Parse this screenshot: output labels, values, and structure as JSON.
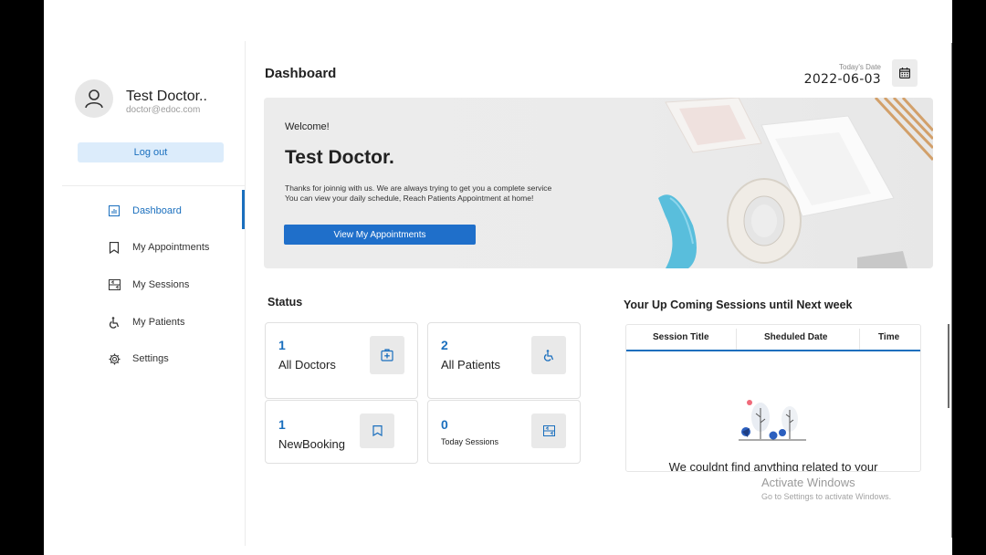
{
  "profile": {
    "name": "Test Doctor..",
    "email": "doctor@edoc.com",
    "avatar_icon": "user-icon"
  },
  "logout_label": "Log out",
  "nav": [
    {
      "label": "Dashboard",
      "icon": "dashboard-icon"
    },
    {
      "label": "My Appointments",
      "icon": "bookmark-icon"
    },
    {
      "label": "My Sessions",
      "icon": "sessions-icon"
    },
    {
      "label": "My Patients",
      "icon": "wheelchair-icon"
    },
    {
      "label": "Settings",
      "icon": "gear-icon"
    }
  ],
  "header": {
    "title": "Dashboard",
    "date_label": "Today's Date",
    "date_value": "2022-06-03",
    "calendar_icon": "calendar-icon"
  },
  "banner": {
    "welcome": "Welcome!",
    "name": "Test Doctor.",
    "line1": "Thanks for joinnig with us. We are always trying to get you a complete service",
    "line2": "You can view your daily schedule, Reach Patients Appointment at home!",
    "button": "View My Appointments"
  },
  "status": {
    "title": "Status",
    "cards": [
      {
        "value": "1",
        "label": "All Doctors",
        "icon": "hospital-icon"
      },
      {
        "value": "2",
        "label": "All Patients",
        "icon": "wheelchair-icon"
      },
      {
        "value": "1",
        "label": "NewBooking",
        "icon": "bookmark-icon"
      },
      {
        "value": "0",
        "label": "Today Sessions",
        "icon": "sessions-icon"
      }
    ]
  },
  "upcoming": {
    "title": "Your Up Coming Sessions until Next week",
    "columns": [
      "Session Title",
      "Sheduled Date",
      "Time"
    ],
    "empty_message": "We couldnt find anything related to your"
  },
  "watermark": {
    "line1": "Activate Windows",
    "line2": "Go to Settings to activate Windows."
  },
  "colors": {
    "accent": "#1a6fbe",
    "button": "#1f6fca",
    "logout_bg": "#dcecfb"
  }
}
